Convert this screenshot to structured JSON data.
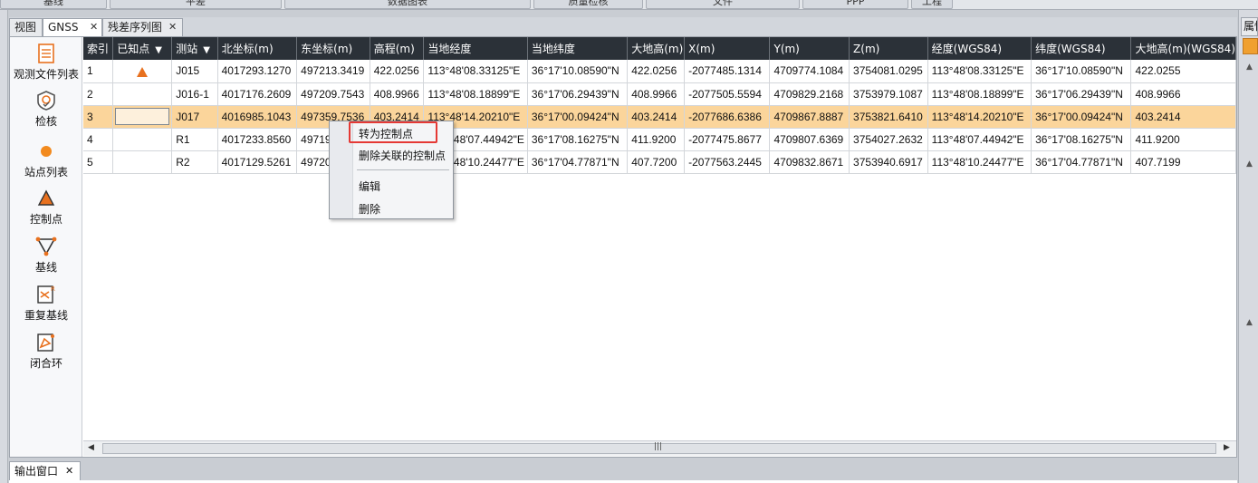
{
  "menubar": {
    "tabs": [
      "基线",
      "平差",
      "数据图表",
      "质量检核",
      "文件",
      "PPP",
      "工程"
    ]
  },
  "tabs": [
    {
      "label": "视图"
    },
    {
      "label": "GNSS"
    },
    {
      "label": "残差序列图"
    }
  ],
  "right_panel": {
    "tab_label": "属性"
  },
  "sidebar": {
    "items": [
      {
        "label": "观测文件列表",
        "icon": "file-list-icon"
      },
      {
        "label": "检核",
        "icon": "qc-check-icon"
      },
      {
        "label": "站点列表",
        "icon": "station-dot-icon",
        "selected": true
      },
      {
        "label": "控制点",
        "icon": "control-point-triangle-icon"
      },
      {
        "label": "基线",
        "icon": "baseline-icon"
      },
      {
        "label": "重复基线",
        "icon": "repeat-baseline-icon"
      },
      {
        "label": "闭合环",
        "icon": "closure-loop-icon"
      }
    ]
  },
  "table": {
    "columns": [
      "索引",
      "已知点",
      "测站",
      "北坐标(m)",
      "东坐标(m)",
      "高程(m)",
      "当地经度",
      "当地纬度",
      "大地高(m)",
      "X(m)",
      "Y(m)",
      "Z(m)",
      "经度(WGS84)",
      "纬度(WGS84)",
      "大地高(m)(WGS84)"
    ],
    "rows": [
      {
        "index": "1",
        "known": true,
        "station": "J015",
        "north": "4017293.1270",
        "east": "497213.3419",
        "elev": "422.0256",
        "lon": "113°48'08.33125\"E",
        "lat": "36°17'10.08590\"N",
        "h": "422.0256",
        "x": "-2077485.1314",
        "y": "4709774.1084",
        "z": "3754081.0295",
        "lon84": "113°48'08.33125\"E",
        "lat84": "36°17'10.08590\"N",
        "h84": "422.0255"
      },
      {
        "index": "2",
        "known": false,
        "station": "J016-1",
        "north": "4017176.2609",
        "east": "497209.7543",
        "elev": "408.9966",
        "lon": "113°48'08.18899\"E",
        "lat": "36°17'06.29439\"N",
        "h": "408.9966",
        "x": "-2077505.5594",
        "y": "4709829.2168",
        "z": "3753979.1087",
        "lon84": "113°48'08.18899\"E",
        "lat84": "36°17'06.29439\"N",
        "h84": "408.9966"
      },
      {
        "index": "3",
        "known": false,
        "station": "J017",
        "north": "4016985.1043",
        "east": "497359.7536",
        "elev": "403.2414",
        "lon": "113°48'14.20210\"E",
        "lat": "36°17'00.09424\"N",
        "h": "403.2414",
        "x": "-2077686.6386",
        "y": "4709867.8887",
        "z": "3753821.6410",
        "lon84": "113°48'14.20210\"E",
        "lat84": "36°17'00.09424\"N",
        "h84": "403.2414",
        "selected": true
      },
      {
        "index": "4",
        "known": false,
        "station": "R1",
        "north": "4017233.8560",
        "east": "49719",
        "elev": "",
        "lon": "48'07.44942\"E",
        "lat": "36°17'08.16275\"N",
        "h": "411.9200",
        "x": "-2077475.8677",
        "y": "4709807.6369",
        "z": "3754027.2632",
        "lon84": "113°48'07.44942\"E",
        "lat84": "36°17'08.16275\"N",
        "h84": "411.9200"
      },
      {
        "index": "5",
        "known": false,
        "station": "R2",
        "north": "4017129.5261",
        "east": "49720",
        "elev": "",
        "lon": "48'10.24477\"E",
        "lat": "36°17'04.77871\"N",
        "h": "407.7200",
        "x": "-2077563.2445",
        "y": "4709832.8671",
        "z": "3753940.6917",
        "lon84": "113°48'10.24477\"E",
        "lat84": "36°17'04.77871\"N",
        "h84": "407.7199"
      }
    ]
  },
  "context_menu": {
    "items": [
      "转为控制点",
      "删除关联的控制点",
      "编辑",
      "删除"
    ]
  },
  "output_tab": {
    "label": "输出窗口"
  },
  "colors": {
    "accent": "#e8711f",
    "highlight_border": "#e53935",
    "header_bg": "#2b3138",
    "selected_row": "#fbd59b"
  }
}
